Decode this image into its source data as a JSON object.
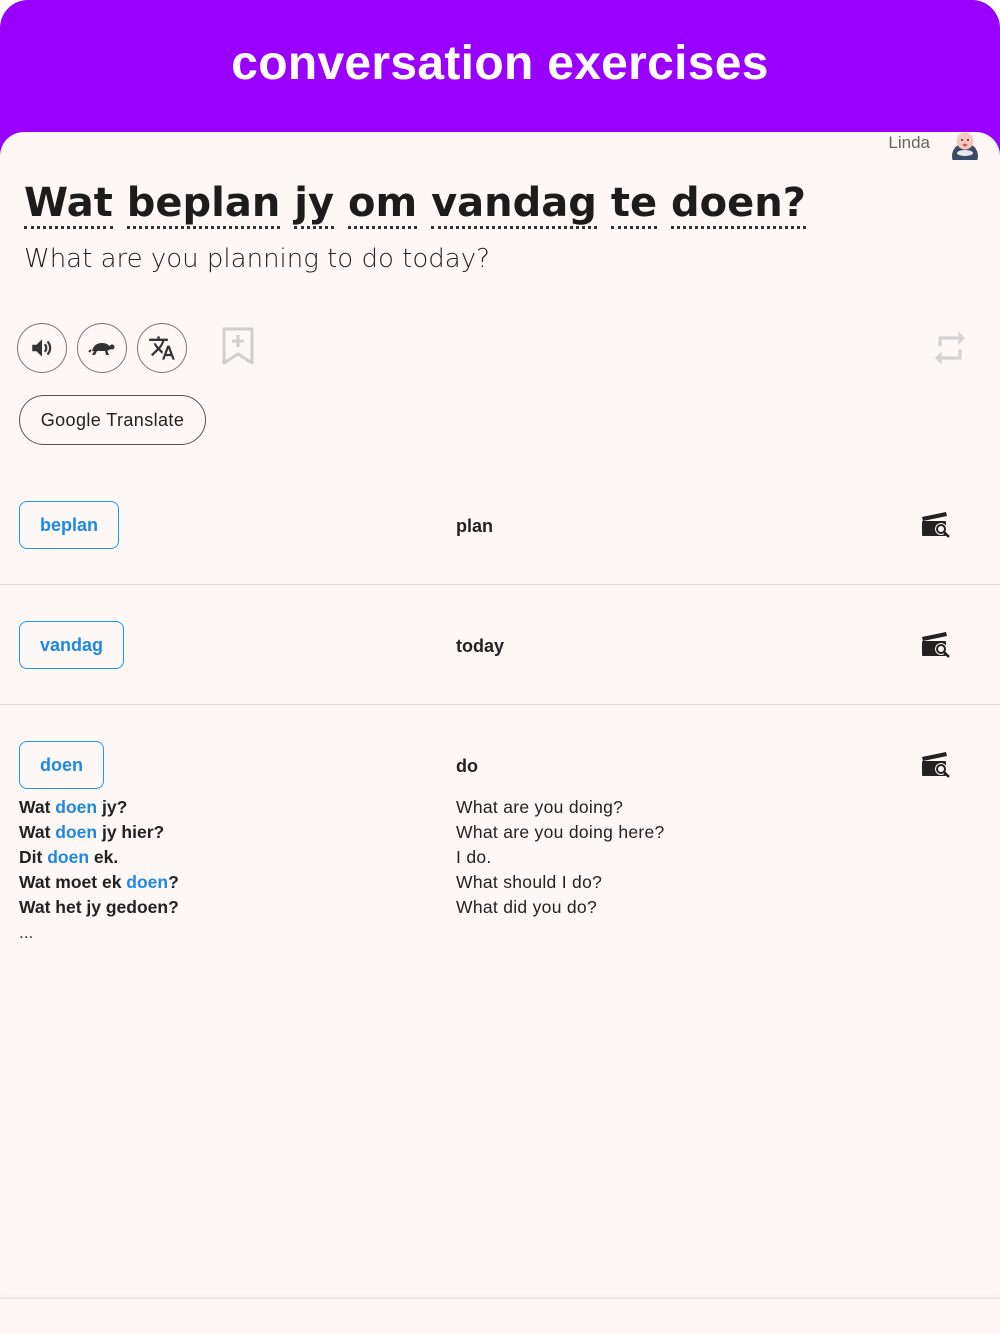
{
  "header": {
    "title": "conversation exercises"
  },
  "partner": {
    "name": "Linda"
  },
  "sentence": {
    "tokens": [
      "Wat",
      "beplan",
      "jy",
      "om",
      "vandag",
      "te",
      "doen?"
    ],
    "translation": "What are you planning to do today?"
  },
  "controls": {
    "speak_icon": "volume-icon",
    "slow_icon": "turtle-icon",
    "translate_icon": "translate-icon",
    "bookmark_icon": "bookmark-add-icon",
    "repeat_icon": "repeat-icon",
    "google_translate_label": "Google Translate"
  },
  "vocab": [
    {
      "word": "beplan",
      "meaning": "plan"
    },
    {
      "word": "vandag",
      "meaning": "today"
    },
    {
      "word": "doen",
      "meaning": "do"
    }
  ],
  "examples": [
    {
      "pre": "Wat ",
      "hl": "doen",
      "post": " jy?",
      "tr": "What are you doing?"
    },
    {
      "pre": "Wat ",
      "hl": "doen",
      "post": " jy hier?",
      "tr": "What are you doing here?"
    },
    {
      "pre": "Dit ",
      "hl": "doen",
      "post": " ek.",
      "tr": "I do."
    },
    {
      "pre": "Wat moet ek ",
      "hl": "doen",
      "post": "?",
      "tr": "What should I do?"
    },
    {
      "pre": "Wat het jy gedoen?",
      "hl": "",
      "post": "",
      "tr": "What did you do?"
    }
  ],
  "more_label": "...",
  "colors": {
    "header": "#9900ff",
    "accent": "#1e88e5",
    "background": "#fdf7f6"
  }
}
